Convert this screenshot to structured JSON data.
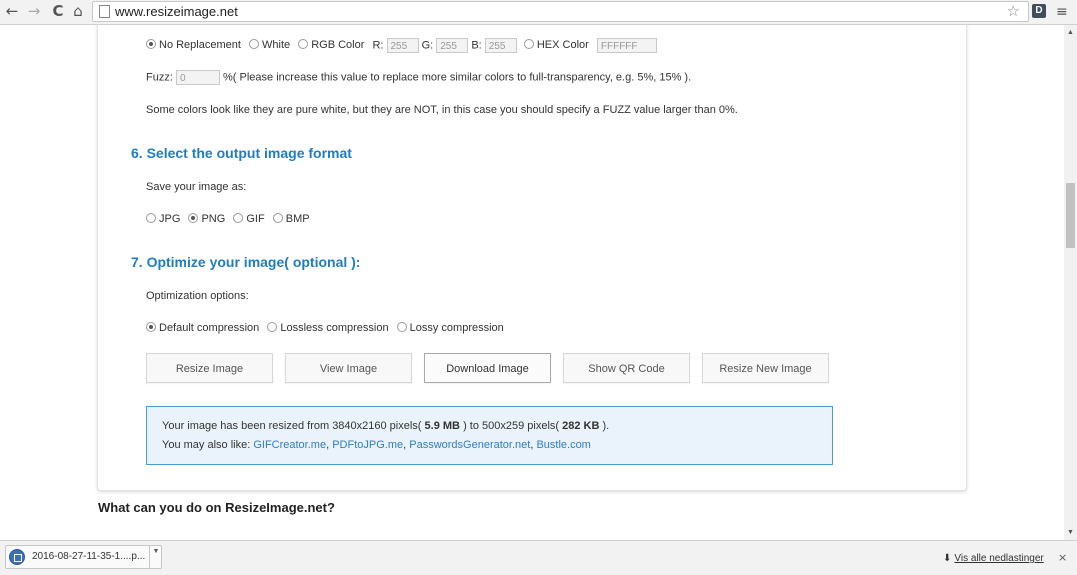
{
  "browser": {
    "url": "www.resizeimage.net",
    "ext_label": "D",
    "back_glyph": "←",
    "forward_glyph": "→",
    "reload_glyph": "C",
    "home_glyph": "⌂",
    "star_glyph": "☆",
    "menu_glyph": "≡"
  },
  "replace": {
    "options": [
      "No Replacement",
      "White",
      "RGB Color"
    ],
    "selected": "No Replacement",
    "r_label": "R:",
    "r_value": "255",
    "g_label": "G:",
    "g_value": "255",
    "b_label": "B:",
    "b_value": "255",
    "hex_option": "HEX Color",
    "hex_value": "FFFFFF",
    "fuzz_label": "Fuzz:",
    "fuzz_value": "0",
    "fuzz_help": "%( Please increase this value to replace more similar colors to full-transparency, e.g. 5%, 15% ).",
    "note": "Some colors look like they are pure white, but they are NOT, in this case you should specify a FUZZ value larger than 0%."
  },
  "section6": {
    "title": "6. Select the output image format",
    "label": "Save your image as:",
    "formats": [
      "JPG",
      "PNG",
      "GIF",
      "BMP"
    ],
    "selected": "PNG"
  },
  "section7": {
    "title": "7. Optimize your image( optional ):",
    "label": "Optimization options:",
    "options": [
      "Default compression",
      "Lossless compression",
      "Lossy compression"
    ],
    "selected": "Default compression"
  },
  "buttons": {
    "resize": "Resize Image",
    "view": "View Image",
    "download": "Download Image",
    "qr": "Show QR Code",
    "resize_new": "Resize New Image"
  },
  "result": {
    "prefix": "Your image has been resized from 3840x2160 pixels(",
    "orig_size": "5.9 MB",
    "middle": ") to 500x259 pixels(",
    "new_size": "282 KB",
    "suffix": ").",
    "also_like": "You may also like:",
    "links": [
      "GIFCreator.me",
      "PDFtoJPG.me",
      "PasswordsGenerator.net",
      "Bustle.com"
    ]
  },
  "bottom_heading": "What can you do on ResizeImage.net?",
  "download_shelf": {
    "file_name": "2016-08-27-11-35-1....p...",
    "show_all": "Vis alle nedlastinger",
    "close_glyph": "×"
  }
}
